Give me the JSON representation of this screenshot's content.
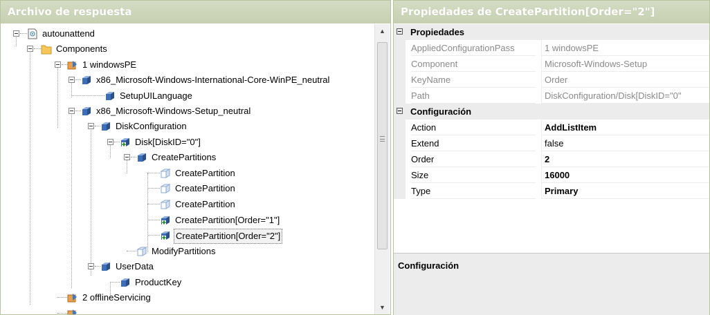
{
  "left_pane": {
    "title": "Archivo de respuesta"
  },
  "tree": {
    "nodes": [
      {
        "label": "autounattend",
        "icon": "answer-file-icon"
      },
      {
        "label": "Components",
        "icon": "folder-icon"
      },
      {
        "label": "1 windowsPE",
        "icon": "pass-icon"
      },
      {
        "label": "x86_Microsoft-Windows-International-Core-WinPE_neutral",
        "icon": "component-icon"
      },
      {
        "label": "SetupUILanguage",
        "icon": "component-icon"
      },
      {
        "label": "x86_Microsoft-Windows-Setup_neutral",
        "icon": "component-icon"
      },
      {
        "label": "DiskConfiguration",
        "icon": "component-icon"
      },
      {
        "label": "Disk[DiskID=\"0\"]",
        "icon": "list-item-icon"
      },
      {
        "label": "CreatePartitions",
        "icon": "component-icon"
      },
      {
        "label": "CreatePartition",
        "icon": "empty-component-icon"
      },
      {
        "label": "CreatePartition",
        "icon": "empty-component-icon"
      },
      {
        "label": "CreatePartition",
        "icon": "empty-component-icon"
      },
      {
        "label": "CreatePartition[Order=\"1\"]",
        "icon": "list-item-icon"
      },
      {
        "label": "CreatePartition[Order=\"2\"]",
        "icon": "list-item-icon"
      },
      {
        "label": "ModifyPartitions",
        "icon": "empty-component-icon"
      },
      {
        "label": "UserData",
        "icon": "component-icon"
      },
      {
        "label": "ProductKey",
        "icon": "component-icon"
      },
      {
        "label": "2 offlineServicing",
        "icon": "pass-icon"
      }
    ]
  },
  "right_pane": {
    "title": "Propiedades de CreatePartition[Order=\"2\"]",
    "categories": [
      {
        "title": "Propiedades",
        "rows": [
          {
            "name": "AppliedConfigurationPass",
            "value": "1 windowsPE"
          },
          {
            "name": "Component",
            "value": "Microsoft-Windows-Setup"
          },
          {
            "name": "KeyName",
            "value": "Order"
          },
          {
            "name": "Path",
            "value": "DiskConfiguration/Disk[DiskID=\"0\""
          }
        ]
      },
      {
        "title": "Configuración",
        "rows": [
          {
            "name": "Action",
            "value": "AddListItem"
          },
          {
            "name": "Extend",
            "value": "false"
          },
          {
            "name": "Order",
            "value": "2"
          },
          {
            "name": "Size",
            "value": "16000"
          },
          {
            "name": "Type",
            "value": "Primary"
          }
        ]
      }
    ],
    "description_title": "Configuración"
  },
  "colors": {
    "title_bar": "#c6d0b0",
    "title_text": "#ffffff",
    "category_bg": "#ececec",
    "readonly_text": "#8a8a8a"
  }
}
